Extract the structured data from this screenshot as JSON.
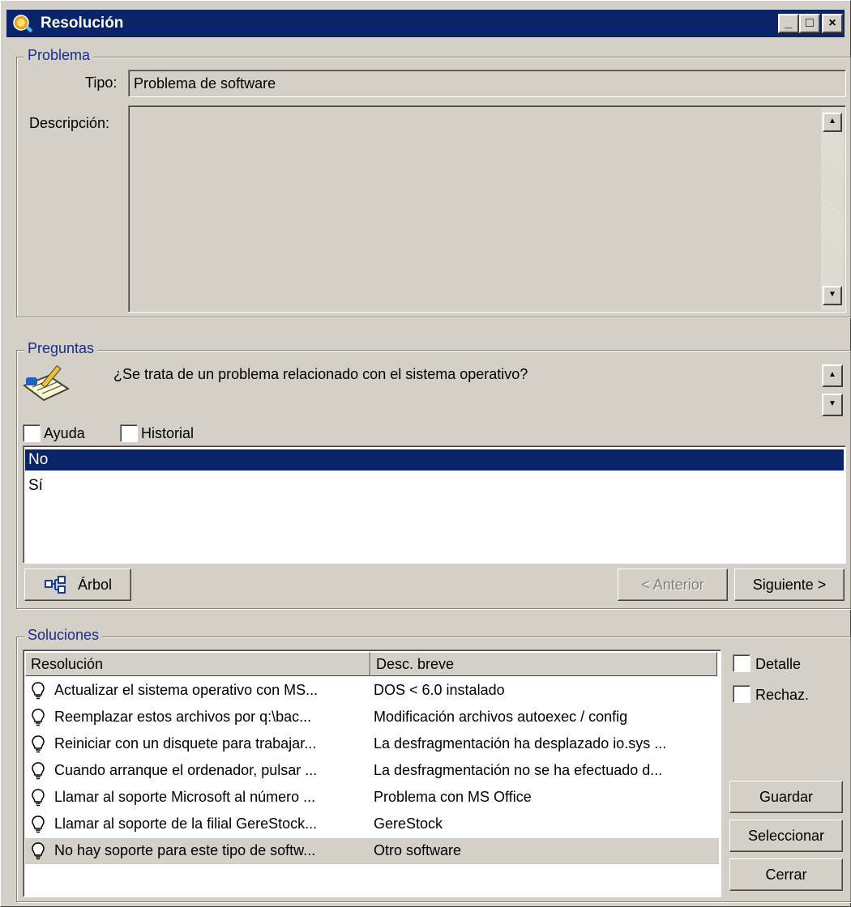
{
  "window": {
    "title": "Resolución",
    "minimize_glyph": "_",
    "maximize_glyph": "□",
    "close_glyph": "×"
  },
  "problema": {
    "legend": "Problema",
    "tipo_label": "Tipo:",
    "tipo_value": "Problema de software",
    "descripcion_label": "Descripción:",
    "descripcion_value": ""
  },
  "preguntas": {
    "legend": "Preguntas",
    "question": "¿Se trata de un problema relacionado con el sistema operativo?",
    "ayuda_label": "Ayuda",
    "historial_label": "Historial",
    "answers": [
      {
        "label": "No",
        "selected": true
      },
      {
        "label": "Sí",
        "selected": false
      }
    ],
    "arbol_label": "Árbol",
    "anterior_label": "< Anterior",
    "siguiente_label": "Siguiente >"
  },
  "soluciones": {
    "legend": "Soluciones",
    "columns": [
      "Resolución",
      "Desc. breve"
    ],
    "rows": [
      {
        "resolucion": "Actualizar el sistema operativo con MS...",
        "desc": "DOS < 6.0 instalado"
      },
      {
        "resolucion": "Reemplazar estos archivos por q:\\bac...",
        "desc": "Modificación archivos autoexec / config"
      },
      {
        "resolucion": "Reiniciar con un disquete para trabajar...",
        "desc": "La desfragmentación ha desplazado io.sys ..."
      },
      {
        "resolucion": "Cuando arranque el ordenador, pulsar ...",
        "desc": "La desfragmentación no se ha efectuado d..."
      },
      {
        "resolucion": "Llamar al soporte Microsoft al número ...",
        "desc": "Problema con MS Office"
      },
      {
        "resolucion": "Llamar al soporte de la filial GereStock...",
        "desc": "GereStock"
      },
      {
        "resolucion": "No hay soporte para este tipo de softw...",
        "desc": "Otro software"
      }
    ],
    "detalle_label": "Detalle",
    "rechaz_label": "Rechaz.",
    "guardar_label": "Guardar",
    "seleccionar_label": "Seleccionar",
    "cerrar_label": "Cerrar"
  },
  "icons": {
    "app": "magnifier-app-icon",
    "question": "notepad-pencil-icon",
    "tree": "tree-icon",
    "solution": "lightbulb-icon"
  }
}
